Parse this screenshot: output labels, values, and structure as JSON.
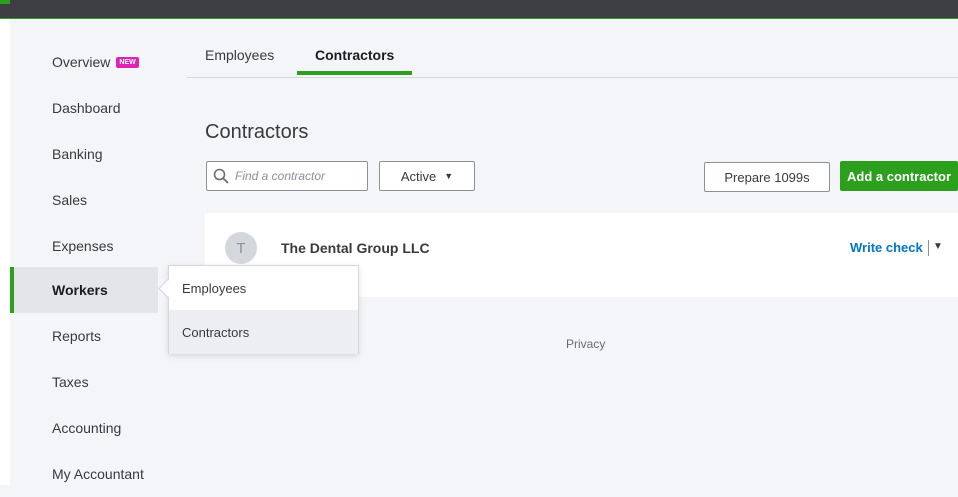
{
  "sidebar": {
    "items": [
      {
        "label": "Overview",
        "badge": "NEW"
      },
      {
        "label": "Dashboard"
      },
      {
        "label": "Banking"
      },
      {
        "label": "Sales"
      },
      {
        "label": "Expenses"
      },
      {
        "label": "Workers",
        "active": true
      },
      {
        "label": "Reports"
      },
      {
        "label": "Taxes"
      },
      {
        "label": "Accounting"
      },
      {
        "label": "My Accountant"
      }
    ]
  },
  "submenu": {
    "items": [
      {
        "label": "Employees"
      },
      {
        "label": "Contractors",
        "hovered": true
      }
    ]
  },
  "tabs": [
    {
      "label": "Employees"
    },
    {
      "label": "Contractors",
      "active": true
    }
  ],
  "page": {
    "title": "Contractors"
  },
  "toolbar": {
    "search_placeholder": "Find a contractor",
    "status_filter": "Active",
    "prepare_label": "Prepare 1099s",
    "add_label": "Add a contractor"
  },
  "contractors": [
    {
      "initial": "T",
      "name": "The Dental Group LLC",
      "action": "Write check"
    }
  ],
  "footer": {
    "privacy": "Privacy"
  },
  "colors": {
    "accent": "#2ca01c",
    "link": "#0077c5",
    "badge": "#e022b3",
    "topbar": "#3d3f42"
  }
}
